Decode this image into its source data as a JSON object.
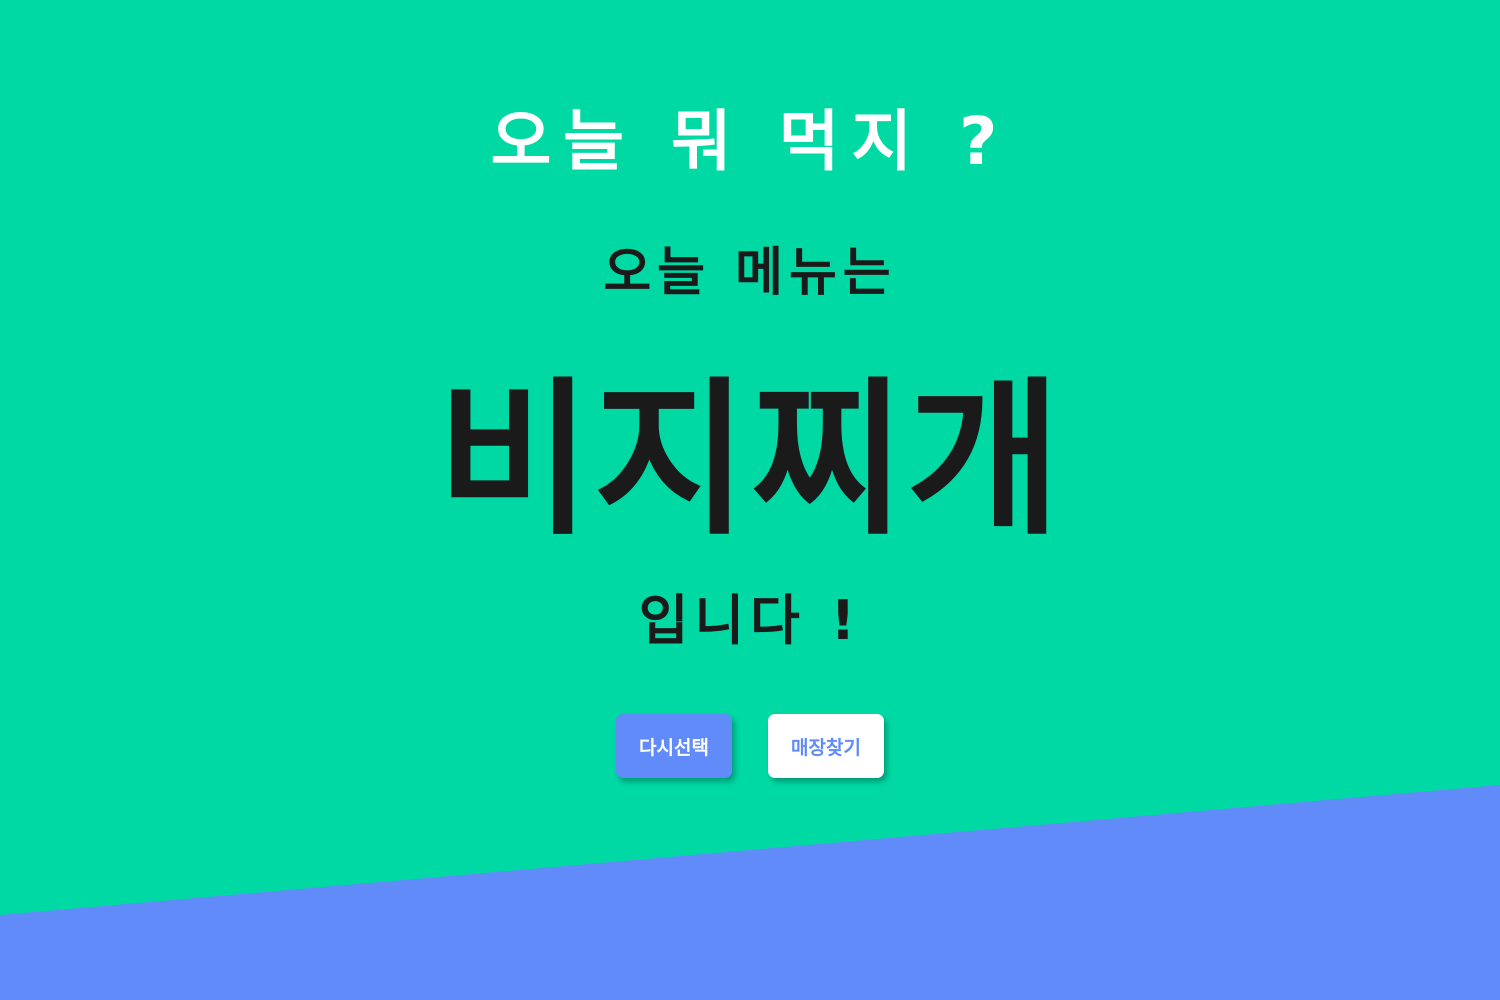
{
  "page": {
    "title": "오늘 뭐 먹지 ?",
    "subtitle": "오늘 메뉴는",
    "menu_name": "비지찌개",
    "suffix": "입니다 !"
  },
  "buttons": {
    "reselect_label": "다시선택",
    "find_store_label": "매장찾기"
  },
  "colors": {
    "background": "#00d9a4",
    "accent_wedge": "#618bf8",
    "title_text": "#ffffff",
    "body_text": "#1a1a1a",
    "primary_button": "#618bf8",
    "secondary_button": "#ffffff"
  }
}
